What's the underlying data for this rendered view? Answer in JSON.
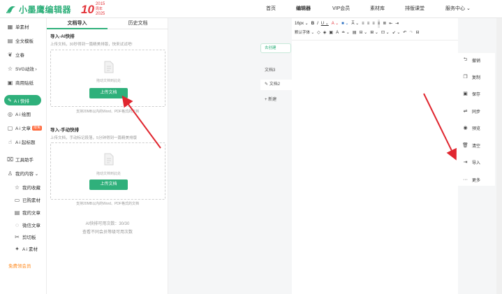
{
  "header": {
    "logo_text": "小墨鹰编辑器",
    "anniv_num": "10",
    "anniv_year_from": "2015",
    "anniv_year_to": "2025",
    "anniv_mid": "周年",
    "nav": [
      {
        "label": "首页"
      },
      {
        "label": "编辑器"
      },
      {
        "label": "VIP会员"
      },
      {
        "label": "素材库"
      },
      {
        "label": "排版课堂"
      },
      {
        "label": "服务中心 ⌄"
      }
    ]
  },
  "sidebar": {
    "items": [
      {
        "label": "单素材",
        "icon": "grid-icon"
      },
      {
        "label": "全文模板",
        "icon": "template-icon"
      },
      {
        "label": "立春",
        "icon": "sprout-icon"
      },
      {
        "label": "SVG动效 ›",
        "icon": "svg-icon"
      },
      {
        "label": "商用贴纸",
        "icon": "sticker-icon"
      },
      {
        "label": "A i 快排",
        "icon": "ai-icon"
      },
      {
        "label": "A i 绘图",
        "icon": "palette-icon"
      },
      {
        "label": "A i 文章",
        "icon": "article-icon",
        "badge": "限免"
      },
      {
        "label": "A i 起标题",
        "icon": "title-icon"
      },
      {
        "label": "工具助手",
        "icon": "tool-icon"
      },
      {
        "label": "我的内容 ⌄",
        "icon": "user-icon"
      },
      {
        "label": "我的收藏",
        "icon": "star-icon"
      },
      {
        "label": "已购素材",
        "icon": "bag-icon"
      },
      {
        "label": "我的文章",
        "icon": "doc-icon"
      },
      {
        "label": "微信文章",
        "icon": "wechat-icon"
      },
      {
        "label": "剪切板",
        "icon": "clipboard-icon"
      },
      {
        "label": "A i 素材",
        "icon": "ai-material-icon"
      }
    ],
    "free_text": "免费领会员"
  },
  "panel": {
    "tabs": [
      "文档导入",
      "历史文档"
    ],
    "ai_section": {
      "title": "导入-AI快排",
      "desc": "上传文档，30秒得到一篇精美排版，快来试试吧!",
      "drop_text": "拖动文档到此处",
      "button": "上传文档",
      "support": "支持20MB以内的Word、PDF格式的文档"
    },
    "manual_section": {
      "title": "导入-手动快排",
      "desc": "上传文档，手动标记段落，5分钟得到一篇精美排版",
      "drop_text": "拖动文档到此处",
      "button": "上传文档",
      "support": "支持20MB以内的Word、PDF格式的文档"
    },
    "quota": "AI快排可用次数：30/30",
    "quota_hint": "查看不同会员等级可用次数"
  },
  "middle": {
    "create_label": "去创建",
    "docs": [
      "文档3",
      "文档2"
    ],
    "new_label": "新建"
  },
  "toolbar": {
    "font_size": "16px ⌄",
    "font_family": "默认字体 ⌄",
    "row1": [
      "B",
      "I",
      "U ⌄",
      "A ⌄",
      "■ ⌄",
      "A̅ ⌄",
      "≡",
      "≡",
      "≡",
      "≡",
      "≣",
      "⇤",
      "⇥"
    ],
    "row2": [
      "◇",
      "◈",
      "▣",
      "A",
      "≐ ⌄",
      "▤",
      "⊟ ⌄",
      "⊞ ⌄",
      "⊡ ⌄",
      "↙ ⌄",
      "↶",
      "↷",
      "⊟"
    ]
  },
  "right_actions": [
    {
      "label": "撤销",
      "icon": "undo-icon"
    },
    {
      "label": "复制",
      "icon": "copy-icon"
    },
    {
      "label": "保存",
      "icon": "save-icon"
    },
    {
      "label": "同步",
      "icon": "sync-icon"
    },
    {
      "label": "预览",
      "icon": "eye-icon"
    },
    {
      "label": "清空",
      "icon": "trash-icon"
    },
    {
      "label": "导入",
      "icon": "import-icon"
    },
    {
      "label": "更多",
      "icon": "more-icon"
    }
  ],
  "colors": {
    "accent": "#2fb07b",
    "anniv_red": "#e3343a",
    "arrow_red": "#e0262f",
    "free_orange": "#ff8a1f"
  }
}
